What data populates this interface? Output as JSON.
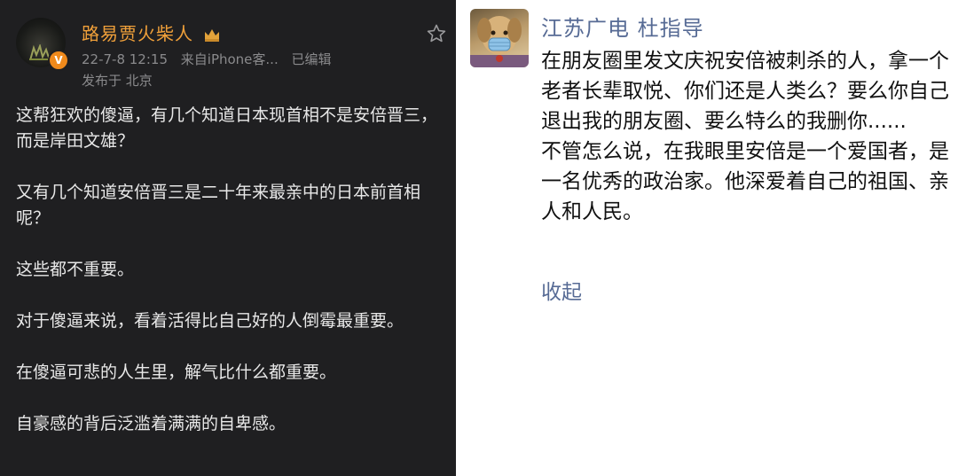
{
  "left_post": {
    "username": "路易贾火柴人",
    "time": "22-7-8 12:15",
    "source": "来自iPhone客...",
    "edited": "已编辑",
    "location": "发布于 北京",
    "paragraphs": [
      "这帮狂欢的傻逼，有几个知道日本现首相不是安倍晋三，而是岸田文雄？",
      "又有几个知道安倍晋三是二十年来最亲中的日本前首相呢？",
      "这些都不重要。",
      "对于傻逼来说，看着活得比自己好的人倒霉最重要。",
      "在傻逼可悲的人生里，解气比什么都重要。",
      "自豪感的背后泛滥着满满的自卑感。"
    ],
    "verify_badge": "V",
    "name_color": "#f0a03a",
    "bg_color": "#1f1f21"
  },
  "right_post": {
    "username": "江苏广电 杜指导",
    "paragraphs": [
      "在朋友圈里发文庆祝安倍被刺杀的人，拿一个老者长辈取悦、你们还是人类么？要么你自己退出我的朋友圈、要么特么的我删你......",
      "不管怎么说，在我眼里安倍是一个爱国者，是一名优秀的政治家。他深爱着自己的祖国、亲人和人民。"
    ],
    "collapse_label": "收起",
    "link_color": "#576b95"
  },
  "icons": {
    "star": "star-icon",
    "crown": "crown-icon",
    "verify": "verified-icon"
  }
}
